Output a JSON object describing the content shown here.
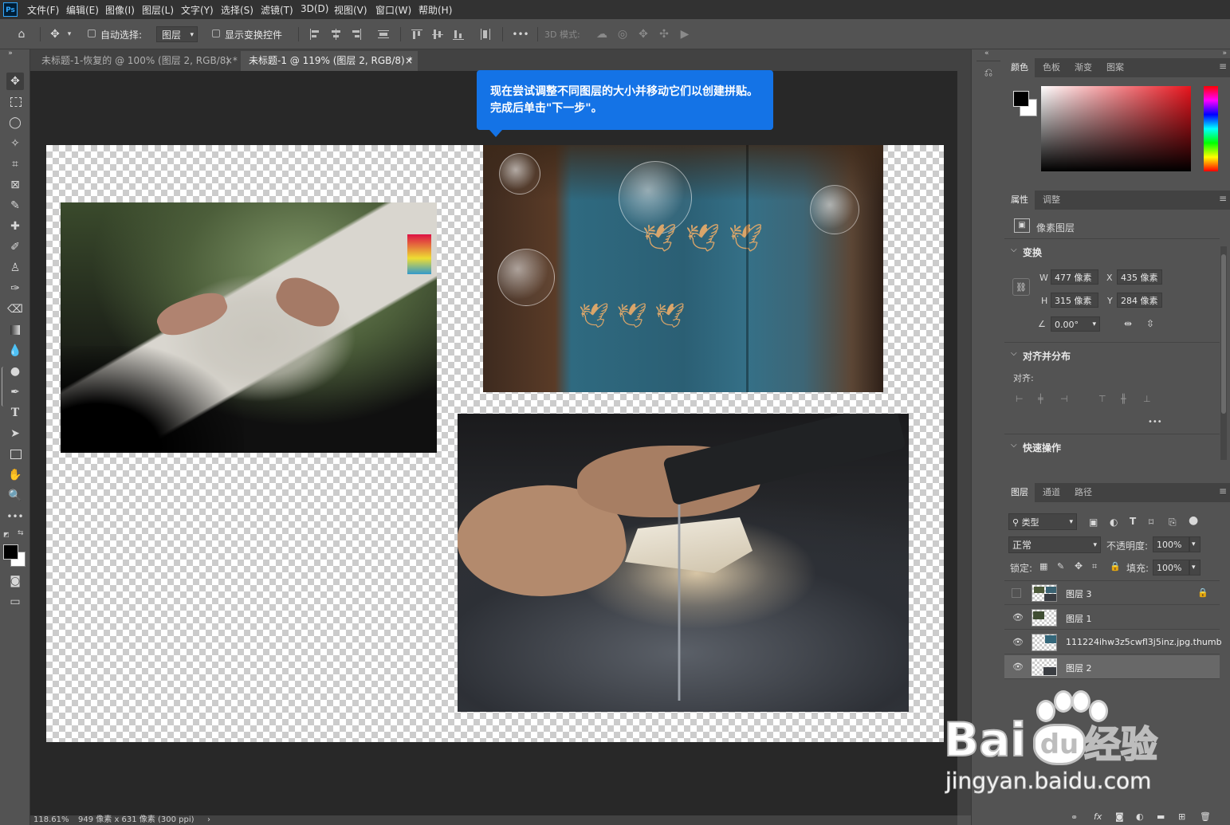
{
  "app": {
    "logo": "Ps"
  },
  "menu": [
    "文件(F)",
    "编辑(E)",
    "图像(I)",
    "图层(L)",
    "文字(Y)",
    "选择(S)",
    "滤镜(T)",
    "3D(D)",
    "视图(V)",
    "窗口(W)",
    "帮助(H)"
  ],
  "options": {
    "auto_select_label": "自动选择:",
    "auto_select_value": "图层",
    "show_transform_label": "显示变换控件",
    "mode_3d_label": "3D 模式:",
    "more": "•••"
  },
  "tabs": [
    {
      "label": "未标题-1-恢复的 @ 100% (图层 2, RGB/8) *",
      "close": "×",
      "active": false
    },
    {
      "label": "未标题-1 @ 119% (图层 2, RGB/8) *",
      "close": "×",
      "active": true
    }
  ],
  "tooltip": {
    "text": "现在尝试调整不同图层的大小并移动它们以创建拼贴。完成后单击\"下一步\"。"
  },
  "status": {
    "zoom": "118.61%",
    "doc_info": "949 像素 x 631 像素 (300 ppi)",
    "arrow": "›"
  },
  "color_panel": {
    "tabs": [
      "颜色",
      "色板",
      "渐变",
      "图案"
    ],
    "foreground": "#000000",
    "background": "#ffffff",
    "hue_base": "#e8141d"
  },
  "properties": {
    "tabs": [
      "属性",
      "调整"
    ],
    "layer_type": "像素图层",
    "transform_title": "变换",
    "w_label": "W",
    "w_value": "477 像素",
    "h_label": "H",
    "h_value": "315 像素",
    "x_label": "X",
    "x_value": "435 像素",
    "y_label": "Y",
    "y_value": "284 像素",
    "angle_value": "0.00°",
    "align_title": "对齐并分布",
    "align_label": "对齐:",
    "quick_title": "快速操作",
    "more": "•••"
  },
  "layers": {
    "tabs": [
      "图层",
      "通道",
      "路径"
    ],
    "filter_value": "类型",
    "blend_value": "正常",
    "opacity_label": "不透明度:",
    "opacity_value": "100%",
    "lock_label": "锁定:",
    "fill_label": "填充:",
    "fill_value": "100%",
    "items": [
      {
        "name": "图层 3",
        "visible": false,
        "locked": true,
        "selected": false
      },
      {
        "name": "图层 1",
        "visible": true,
        "locked": false,
        "selected": false
      },
      {
        "name": "111224ihw3z5cwfl3j5inz.jpg.thumb",
        "visible": true,
        "locked": false,
        "selected": false
      },
      {
        "name": "图层 2",
        "visible": true,
        "locked": false,
        "selected": true
      }
    ],
    "footer_icons": [
      "link-icon",
      "fx-icon",
      "mask-icon",
      "adjustment-icon",
      "folder-icon",
      "new-layer-icon",
      "trash-icon"
    ]
  },
  "watermark": {
    "brand": "Bai",
    "brand2": "经验",
    "url": "jingyan.baidu.com"
  }
}
